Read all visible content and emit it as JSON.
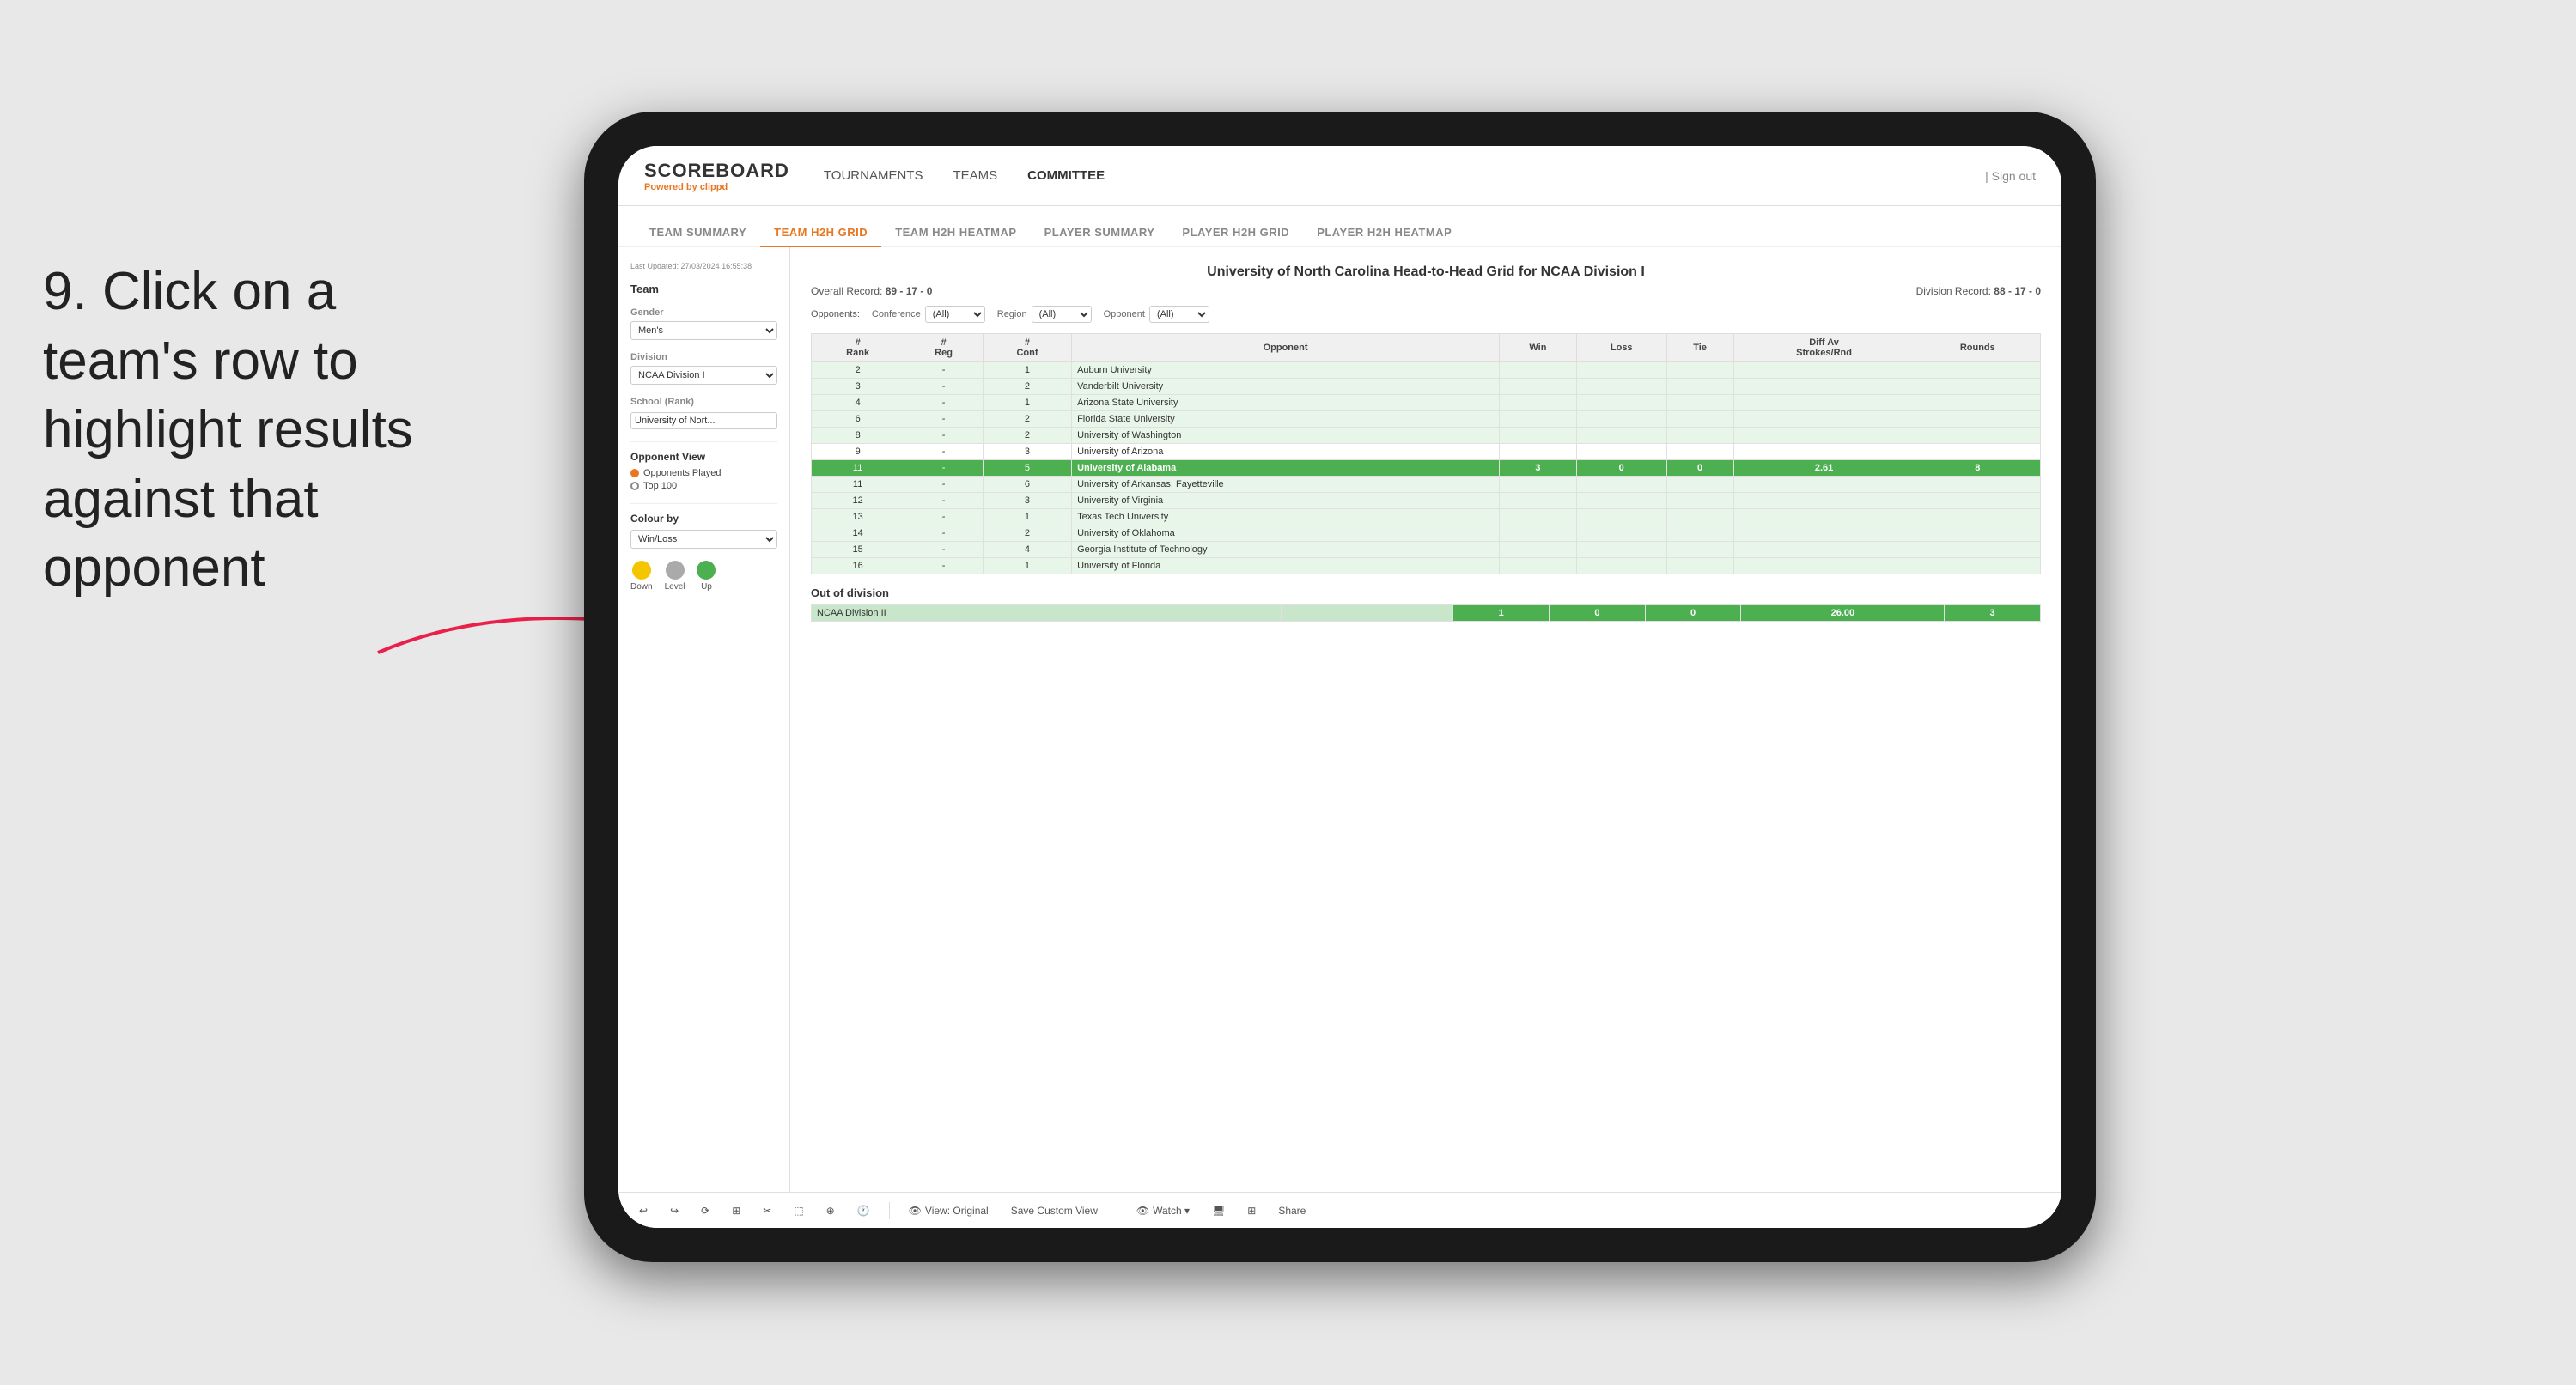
{
  "instruction": {
    "step": "9.",
    "text": "Click on a team's row to highlight results against that opponent"
  },
  "nav": {
    "logo": "SCOREBOARD",
    "logo_powered": "Powered by",
    "logo_brand": "clippd",
    "links": [
      "TOURNAMENTS",
      "TEAMS",
      "COMMITTEE"
    ],
    "active_link": "COMMITTEE",
    "sign_out": "| Sign out"
  },
  "sub_nav": {
    "items": [
      "TEAM SUMMARY",
      "TEAM H2H GRID",
      "TEAM H2H HEATMAP",
      "PLAYER SUMMARY",
      "PLAYER H2H GRID",
      "PLAYER H2H HEATMAP"
    ],
    "active": "TEAM H2H GRID"
  },
  "sidebar": {
    "timestamp": "Last Updated: 27/03/2024\n16:55:38",
    "team_label": "Team",
    "gender_label": "Gender",
    "gender_value": "Men's",
    "division_label": "Division",
    "division_value": "NCAA Division I",
    "school_label": "School (Rank)",
    "school_value": "University of Nort...",
    "opponent_view_title": "Opponent View",
    "radio_opponents_played": "Opponents Played",
    "radio_top100": "Top 100",
    "colour_by_title": "Colour by",
    "colour_by_value": "Win/Loss",
    "legend": [
      {
        "color": "#f5c600",
        "label": "Down"
      },
      {
        "color": "#aaaaaa",
        "label": "Level"
      },
      {
        "color": "#4CAF50",
        "label": "Up"
      }
    ]
  },
  "grid": {
    "title": "University of North Carolina Head-to-Head Grid for NCAA Division I",
    "overall_record_label": "Overall Record:",
    "overall_record": "89 - 17 - 0",
    "division_record_label": "Division Record:",
    "division_record": "88 - 17 - 0",
    "filters": {
      "opponents_label": "Opponents:",
      "conference_label": "Conference",
      "conference_value": "(All)",
      "region_label": "Region",
      "region_value": "(All)",
      "opponent_label": "Opponent",
      "opponent_value": "(All)"
    },
    "table_headers": [
      "#\nRank",
      "#\nReg",
      "#\nConf",
      "Opponent",
      "Win",
      "Loss",
      "Tie",
      "Diff Av\nStrokes/Rnd",
      "Rounds"
    ],
    "rows": [
      {
        "rank": "2",
        "reg": "-",
        "conf": "1",
        "opponent": "Auburn University",
        "win": "",
        "loss": "",
        "tie": "",
        "diff": "",
        "rounds": "",
        "highlight": false,
        "color": "light-green"
      },
      {
        "rank": "3",
        "reg": "-",
        "conf": "2",
        "opponent": "Vanderbilt University",
        "win": "",
        "loss": "",
        "tie": "",
        "diff": "",
        "rounds": "",
        "highlight": false,
        "color": "light-green"
      },
      {
        "rank": "4",
        "reg": "-",
        "conf": "1",
        "opponent": "Arizona State University",
        "win": "",
        "loss": "",
        "tie": "",
        "diff": "",
        "rounds": "",
        "highlight": false,
        "color": "light-green"
      },
      {
        "rank": "6",
        "reg": "-",
        "conf": "2",
        "opponent": "Florida State University",
        "win": "",
        "loss": "",
        "tie": "",
        "diff": "",
        "rounds": "",
        "highlight": false,
        "color": "light-green"
      },
      {
        "rank": "8",
        "reg": "-",
        "conf": "2",
        "opponent": "University of Washington",
        "win": "",
        "loss": "",
        "tie": "",
        "diff": "",
        "rounds": "",
        "highlight": false,
        "color": "light-green"
      },
      {
        "rank": "9",
        "reg": "-",
        "conf": "3",
        "opponent": "University of Arizona",
        "win": "",
        "loss": "",
        "tie": "",
        "diff": "",
        "rounds": "",
        "highlight": false,
        "color": ""
      },
      {
        "rank": "11",
        "reg": "-",
        "conf": "5",
        "opponent": "University of Alabama",
        "win": "3",
        "loss": "0",
        "tie": "0",
        "diff": "2.61",
        "rounds": "8",
        "highlight": true,
        "color": "green"
      },
      {
        "rank": "11",
        "reg": "-",
        "conf": "6",
        "opponent": "University of Arkansas, Fayetteville",
        "win": "",
        "loss": "",
        "tie": "",
        "diff": "",
        "rounds": "",
        "highlight": false,
        "color": "light-green"
      },
      {
        "rank": "12",
        "reg": "-",
        "conf": "3",
        "opponent": "University of Virginia",
        "win": "",
        "loss": "",
        "tie": "",
        "diff": "",
        "rounds": "",
        "highlight": false,
        "color": "light-green"
      },
      {
        "rank": "13",
        "reg": "-",
        "conf": "1",
        "opponent": "Texas Tech University",
        "win": "",
        "loss": "",
        "tie": "",
        "diff": "",
        "rounds": "",
        "highlight": false,
        "color": "light-green"
      },
      {
        "rank": "14",
        "reg": "-",
        "conf": "2",
        "opponent": "University of Oklahoma",
        "win": "",
        "loss": "",
        "tie": "",
        "diff": "",
        "rounds": "",
        "highlight": false,
        "color": "light-green"
      },
      {
        "rank": "15",
        "reg": "-",
        "conf": "4",
        "opponent": "Georgia Institute of Technology",
        "win": "",
        "loss": "",
        "tie": "",
        "diff": "",
        "rounds": "",
        "highlight": false,
        "color": "light-green"
      },
      {
        "rank": "16",
        "reg": "-",
        "conf": "1",
        "opponent": "University of Florida",
        "win": "",
        "loss": "",
        "tie": "",
        "diff": "",
        "rounds": "",
        "highlight": false,
        "color": "light-green"
      }
    ],
    "out_of_division_title": "Out of division",
    "out_division_row": {
      "label": "NCAA Division II",
      "win": "1",
      "loss": "0",
      "tie": "0",
      "diff": "26.00",
      "rounds": "3"
    }
  },
  "toolbar": {
    "buttons": [
      "↩",
      "↪",
      "⟳",
      "⊞",
      "✂",
      "⬚",
      "⊕",
      "🕐",
      "View: Original",
      "Save Custom View",
      "👁 Watch ▾",
      "🖥",
      "⊞",
      "Share"
    ]
  }
}
